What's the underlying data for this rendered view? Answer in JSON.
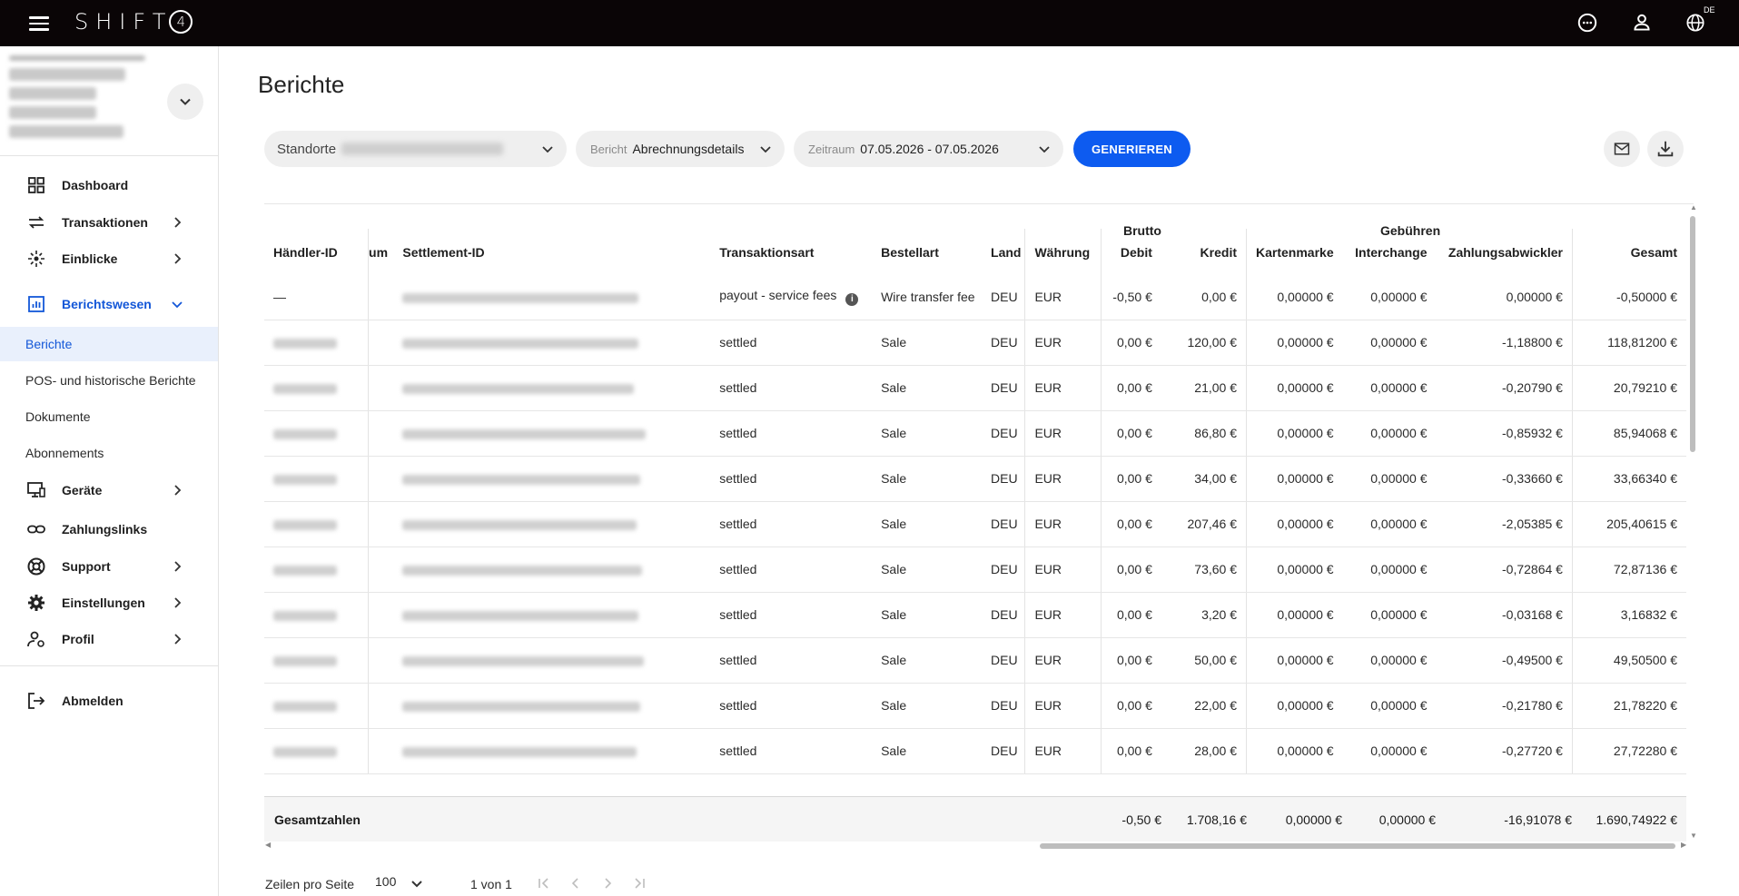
{
  "topbar": {
    "brand": "SHIFT",
    "brand_mark": "4",
    "lang": "DE",
    "icons": [
      "chat-icon",
      "user-icon",
      "globe-icon"
    ]
  },
  "sidebar": {
    "nav": [
      {
        "label": "Dashboard",
        "icon": "dashboard-icon"
      },
      {
        "label": "Transaktionen",
        "icon": "transfer-icon"
      },
      {
        "label": "Einblicke",
        "icon": "insights-icon"
      },
      {
        "label": "Berichtswesen",
        "icon": "report-icon",
        "active": true
      },
      {
        "label": "Geräte",
        "icon": "device-icon"
      },
      {
        "label": "Zahlungslinks",
        "icon": "link-icon"
      },
      {
        "label": "Support",
        "icon": "lifebuoy-icon"
      },
      {
        "label": "Einstellungen",
        "icon": "gear-icon"
      },
      {
        "label": "Profil",
        "icon": "profile-icon"
      }
    ],
    "sub": [
      "Berichte",
      "POS- und historische Berichte",
      "Dokumente",
      "Abonnements"
    ],
    "logout": "Abmelden"
  },
  "main": {
    "title": "Berichte",
    "filters": {
      "locations_label": "Standorte",
      "report_label": "Bericht",
      "report_value": "Abrechnungsdetails",
      "period_label": "Zeitraum",
      "period_value": "07.05.2026 - 07.05.2026"
    },
    "generate": "GENERIEREN"
  },
  "table": {
    "group_headers": {
      "brutto": "Brutto",
      "fees": "Gebühren"
    },
    "columns": {
      "merchant": "Händler-ID",
      "date": "um",
      "settlement": "Settlement-ID",
      "type": "Transaktionsart",
      "order": "Bestellart",
      "country": "Land",
      "currency": "Währung",
      "debit": "Debit",
      "credit": "Kredit",
      "brand": "Kartenmarke",
      "interchange": "Interchange",
      "processor": "Zahlungsabwickler",
      "total": "Gesamt"
    },
    "first_row": {
      "merchant": "—",
      "type": "payout - service fees",
      "order": "Wire transfer fee",
      "country": "DEU",
      "currency": "EUR",
      "debit": "-0,50 €",
      "credit": "0,00 €",
      "brand": "0,00000 €",
      "interchange": "0,00000 €",
      "processor": "0,00000 €",
      "total": "-0,50000 €"
    },
    "rows": [
      {
        "type": "settled",
        "order": "Sale",
        "country": "DEU",
        "currency": "EUR",
        "debit": "0,00 €",
        "credit": "120,00 €",
        "brand": "0,00000 €",
        "interchange": "0,00000 €",
        "processor": "-1,18800 €",
        "total": "118,81200 €"
      },
      {
        "type": "settled",
        "order": "Sale",
        "country": "DEU",
        "currency": "EUR",
        "debit": "0,00 €",
        "credit": "21,00 €",
        "brand": "0,00000 €",
        "interchange": "0,00000 €",
        "processor": "-0,20790 €",
        "total": "20,79210 €"
      },
      {
        "type": "settled",
        "order": "Sale",
        "country": "DEU",
        "currency": "EUR",
        "debit": "0,00 €",
        "credit": "86,80 €",
        "brand": "0,00000 €",
        "interchange": "0,00000 €",
        "processor": "-0,85932 €",
        "total": "85,94068 €"
      },
      {
        "type": "settled",
        "order": "Sale",
        "country": "DEU",
        "currency": "EUR",
        "debit": "0,00 €",
        "credit": "34,00 €",
        "brand": "0,00000 €",
        "interchange": "0,00000 €",
        "processor": "-0,33660 €",
        "total": "33,66340 €"
      },
      {
        "type": "settled",
        "order": "Sale",
        "country": "DEU",
        "currency": "EUR",
        "debit": "0,00 €",
        "credit": "207,46 €",
        "brand": "0,00000 €",
        "interchange": "0,00000 €",
        "processor": "-2,05385 €",
        "total": "205,40615 €"
      },
      {
        "type": "settled",
        "order": "Sale",
        "country": "DEU",
        "currency": "EUR",
        "debit": "0,00 €",
        "credit": "73,60 €",
        "brand": "0,00000 €",
        "interchange": "0,00000 €",
        "processor": "-0,72864 €",
        "total": "72,87136 €"
      },
      {
        "type": "settled",
        "order": "Sale",
        "country": "DEU",
        "currency": "EUR",
        "debit": "0,00 €",
        "credit": "3,20 €",
        "brand": "0,00000 €",
        "interchange": "0,00000 €",
        "processor": "-0,03168 €",
        "total": "3,16832 €"
      },
      {
        "type": "settled",
        "order": "Sale",
        "country": "DEU",
        "currency": "EUR",
        "debit": "0,00 €",
        "credit": "50,00 €",
        "brand": "0,00000 €",
        "interchange": "0,00000 €",
        "processor": "-0,49500 €",
        "total": "49,50500 €"
      },
      {
        "type": "settled",
        "order": "Sale",
        "country": "DEU",
        "currency": "EUR",
        "debit": "0,00 €",
        "credit": "22,00 €",
        "brand": "0,00000 €",
        "interchange": "0,00000 €",
        "processor": "-0,21780 €",
        "total": "21,78220 €"
      },
      {
        "type": "settled",
        "order": "Sale",
        "country": "DEU",
        "currency": "EUR",
        "debit": "0,00 €",
        "credit": "28,00 €",
        "brand": "0,00000 €",
        "interchange": "0,00000 €",
        "processor": "-0,27720 €",
        "total": "27,72280 €"
      }
    ],
    "totals": {
      "label": "Gesamtzahlen",
      "debit": "-0,50 €",
      "credit": "1.708,16 €",
      "brand": "0,00000 €",
      "interchange": "0,00000 €",
      "processor": "-16,91078 €",
      "total": "1.690,74922 €"
    }
  },
  "pager": {
    "rows_label": "Zeilen pro Seite",
    "rows_value": "100",
    "range": "1 von 1"
  },
  "colors": {
    "accent": "#0d5bf0",
    "active_nav": "#1357d8",
    "topbar": "#0a0506"
  }
}
